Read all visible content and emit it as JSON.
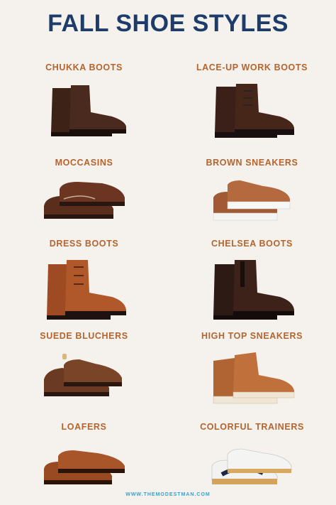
{
  "title": "FALL SHOE STYLES",
  "items": [
    {
      "label": "CHUKKA BOOTS",
      "icon": "chukka-boot-icon"
    },
    {
      "label": "LACE-UP WORK BOOTS",
      "icon": "work-boot-icon"
    },
    {
      "label": "MOCCASINS",
      "icon": "moccasin-icon"
    },
    {
      "label": "BROWN SNEAKERS",
      "icon": "sneaker-icon"
    },
    {
      "label": "DRESS BOOTS",
      "icon": "dress-boot-icon"
    },
    {
      "label": "CHELSEA BOOTS",
      "icon": "chelsea-boot-icon"
    },
    {
      "label": "SUEDE BLUCHERS",
      "icon": "blucher-icon"
    },
    {
      "label": "HIGH TOP SNEAKERS",
      "icon": "high-top-sneaker-icon"
    },
    {
      "label": "LOAFERS",
      "icon": "loafer-icon"
    },
    {
      "label": "COLORFUL TRAINERS",
      "icon": "trainer-icon"
    }
  ],
  "footer": "WWW.THEMODESTMAN.COM",
  "colors": {
    "title": "#1d3c6a",
    "label": "#b5642d",
    "footer": "#3aa0c8",
    "background": "#f5f2ee"
  }
}
